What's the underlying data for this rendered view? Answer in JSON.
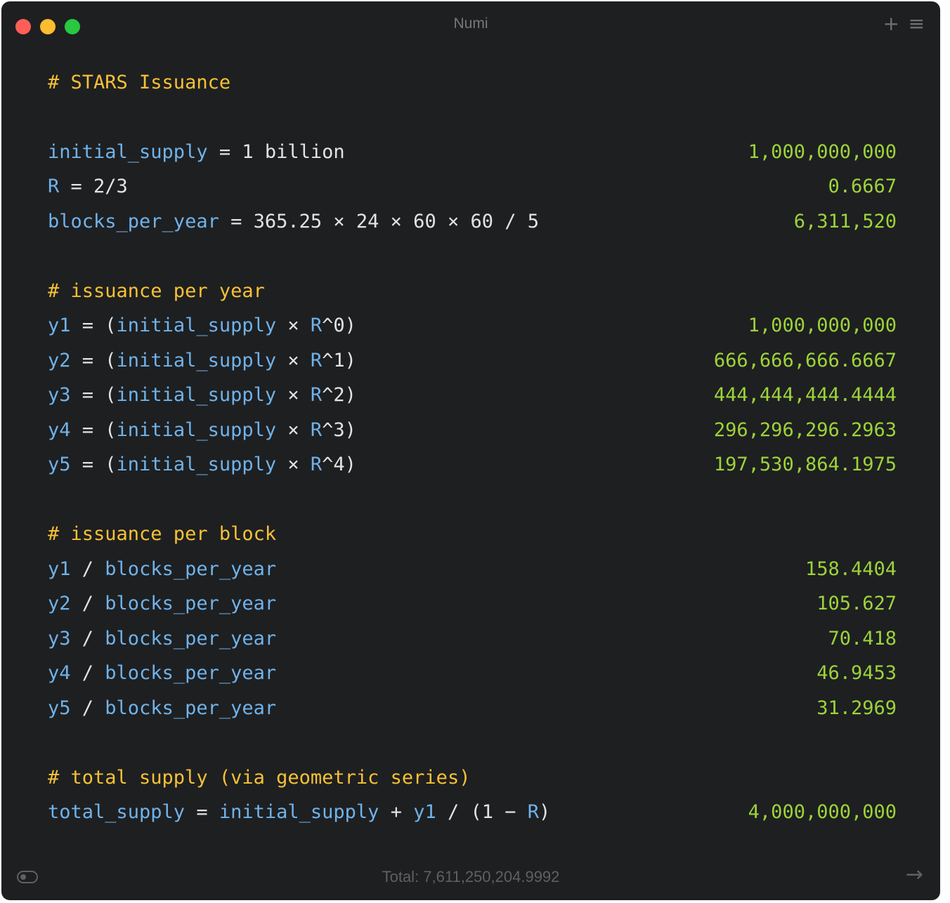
{
  "window": {
    "title": "Numi",
    "icons": [
      "close-button",
      "minimize-button",
      "maximize-button",
      "plus-icon",
      "hamburger-menu-icon"
    ]
  },
  "lines": [
    {
      "expr": [
        {
          "t": "# STARS Issuance",
          "c": "hdr"
        }
      ],
      "result": ""
    },
    {
      "expr": [
        {
          "t": "initial_supply",
          "c": "v"
        },
        {
          "t": " = 1 billion",
          "c": "o"
        }
      ],
      "result": "1,000,000,000"
    },
    {
      "expr": [
        {
          "t": "R",
          "c": "v"
        },
        {
          "t": " = 2/3",
          "c": "o"
        }
      ],
      "result": "0.6667"
    },
    {
      "expr": [
        {
          "t": "blocks_per_year",
          "c": "v"
        },
        {
          "t": " = 365.25 × 24 × 60 × 60 / 5",
          "c": "o"
        }
      ],
      "result": "6,311,520"
    },
    {
      "expr": [
        {
          "t": "# issuance per year",
          "c": "hdr"
        }
      ],
      "result": ""
    },
    {
      "expr": [
        {
          "t": "y1",
          "c": "v"
        },
        {
          "t": " = (",
          "c": "o"
        },
        {
          "t": "initial_supply",
          "c": "v"
        },
        {
          "t": " × ",
          "c": "o"
        },
        {
          "t": "R",
          "c": "v"
        },
        {
          "t": "^0)",
          "c": "o"
        }
      ],
      "result": "1,000,000,000"
    },
    {
      "expr": [
        {
          "t": "y2",
          "c": "v"
        },
        {
          "t": " = (",
          "c": "o"
        },
        {
          "t": "initial_supply",
          "c": "v"
        },
        {
          "t": " × ",
          "c": "o"
        },
        {
          "t": "R",
          "c": "v"
        },
        {
          "t": "^1)",
          "c": "o"
        }
      ],
      "result": "666,666,666.6667"
    },
    {
      "expr": [
        {
          "t": "y3",
          "c": "v"
        },
        {
          "t": " = (",
          "c": "o"
        },
        {
          "t": "initial_supply",
          "c": "v"
        },
        {
          "t": " × ",
          "c": "o"
        },
        {
          "t": "R",
          "c": "v"
        },
        {
          "t": "^2)",
          "c": "o"
        }
      ],
      "result": "444,444,444.4444"
    },
    {
      "expr": [
        {
          "t": "y4",
          "c": "v"
        },
        {
          "t": " = (",
          "c": "o"
        },
        {
          "t": "initial_supply",
          "c": "v"
        },
        {
          "t": " × ",
          "c": "o"
        },
        {
          "t": "R",
          "c": "v"
        },
        {
          "t": "^3)",
          "c": "o"
        }
      ],
      "result": "296,296,296.2963"
    },
    {
      "expr": [
        {
          "t": "y5",
          "c": "v"
        },
        {
          "t": " = (",
          "c": "o"
        },
        {
          "t": "initial_supply",
          "c": "v"
        },
        {
          "t": " × ",
          "c": "o"
        },
        {
          "t": "R",
          "c": "v"
        },
        {
          "t": "^4)",
          "c": "o"
        }
      ],
      "result": "197,530,864.1975"
    },
    {
      "expr": [
        {
          "t": "# issuance per block",
          "c": "hdr"
        }
      ],
      "result": ""
    },
    {
      "expr": [
        {
          "t": "y1",
          "c": "v"
        },
        {
          "t": " / ",
          "c": "o"
        },
        {
          "t": "blocks_per_year",
          "c": "v"
        }
      ],
      "result": "158.4404"
    },
    {
      "expr": [
        {
          "t": "y2",
          "c": "v"
        },
        {
          "t": " / ",
          "c": "o"
        },
        {
          "t": "blocks_per_year",
          "c": "v"
        }
      ],
      "result": "105.627"
    },
    {
      "expr": [
        {
          "t": "y3",
          "c": "v"
        },
        {
          "t": " / ",
          "c": "o"
        },
        {
          "t": "blocks_per_year",
          "c": "v"
        }
      ],
      "result": "70.418"
    },
    {
      "expr": [
        {
          "t": "y4",
          "c": "v"
        },
        {
          "t": " / ",
          "c": "o"
        },
        {
          "t": "blocks_per_year",
          "c": "v"
        }
      ],
      "result": "46.9453"
    },
    {
      "expr": [
        {
          "t": "y5",
          "c": "v"
        },
        {
          "t": " / ",
          "c": "o"
        },
        {
          "t": "blocks_per_year",
          "c": "v"
        }
      ],
      "result": "31.2969"
    },
    {
      "expr": [
        {
          "t": "# total supply (via geometric series)",
          "c": "hdr"
        }
      ],
      "result": ""
    },
    {
      "expr": [
        {
          "t": "total_supply",
          "c": "v"
        },
        {
          "t": " = ",
          "c": "o"
        },
        {
          "t": "initial_supply",
          "c": "v"
        },
        {
          "t": " + ",
          "c": "o"
        },
        {
          "t": "y1",
          "c": "v"
        },
        {
          "t": " / (1 − ",
          "c": "o"
        },
        {
          "t": "R",
          "c": "v"
        },
        {
          "t": ")",
          "c": "o"
        }
      ],
      "result": "4,000,000,000"
    }
  ],
  "footer": {
    "total": "Total: 7,611,250,204.9992",
    "icons": [
      "toggle-icon",
      "arrow-right-icon"
    ]
  },
  "colors": {
    "background": "#1e1f21",
    "header": "#f6c135",
    "variable": "#6fb3ea",
    "operator": "#e2e3e5",
    "result": "#9dd33a"
  }
}
